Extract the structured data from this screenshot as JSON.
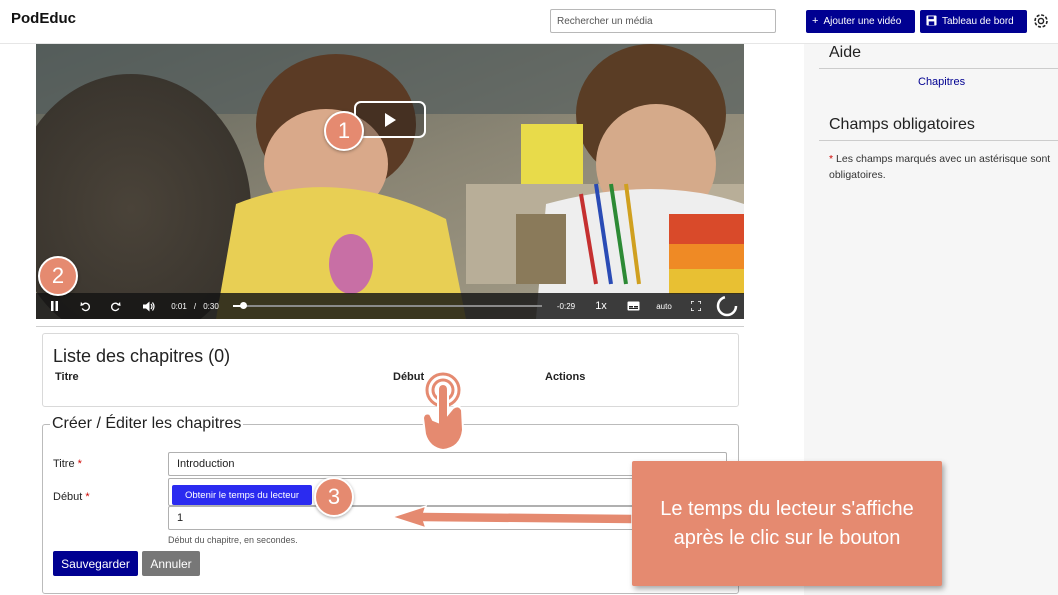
{
  "header": {
    "logo": "PodEduc",
    "search_placeholder": "Rechercher un média",
    "add_video_label": "Ajouter une vidéo",
    "dashboard_label": "Tableau de bord"
  },
  "sidebar": {
    "help_heading": "Aide",
    "help_link": "Chapitres",
    "required_heading": "Champs obligatoires",
    "required_star": "*",
    "required_note": " Les champs marqués avec un astérisque sont obligatoires."
  },
  "player": {
    "current_time": "0:01",
    "separator": "/",
    "duration": "0:30",
    "remaining": "-0:29",
    "speed": "1x",
    "quality": "auto",
    "progress_fraction": 0.033
  },
  "chapters_list": {
    "title": "Liste des chapitres (0)",
    "columns": [
      "Titre",
      "Début",
      "Actions"
    ]
  },
  "form": {
    "legend": "Créer / Éditer les chapitres",
    "title_label": "Titre",
    "title_value": "Introduction",
    "start_label": "Début",
    "required_star": "*",
    "get_time_button": "Obtenir le temps du lecteur",
    "start_value": "1",
    "start_hint": "Début du chapitre, en secondes.",
    "save_button": "Sauvegarder",
    "cancel_button": "Annuler"
  },
  "tutorial": {
    "badge_1": "1",
    "badge_2": "2",
    "badge_3": "3",
    "callout_text": "Le temps du lecteur s'affiche après le clic sur le bouton",
    "accent_color": "#e58a70"
  },
  "colors": {
    "primary": "#000091",
    "secondary_button": "#777777",
    "required_star": "#ce0500"
  }
}
